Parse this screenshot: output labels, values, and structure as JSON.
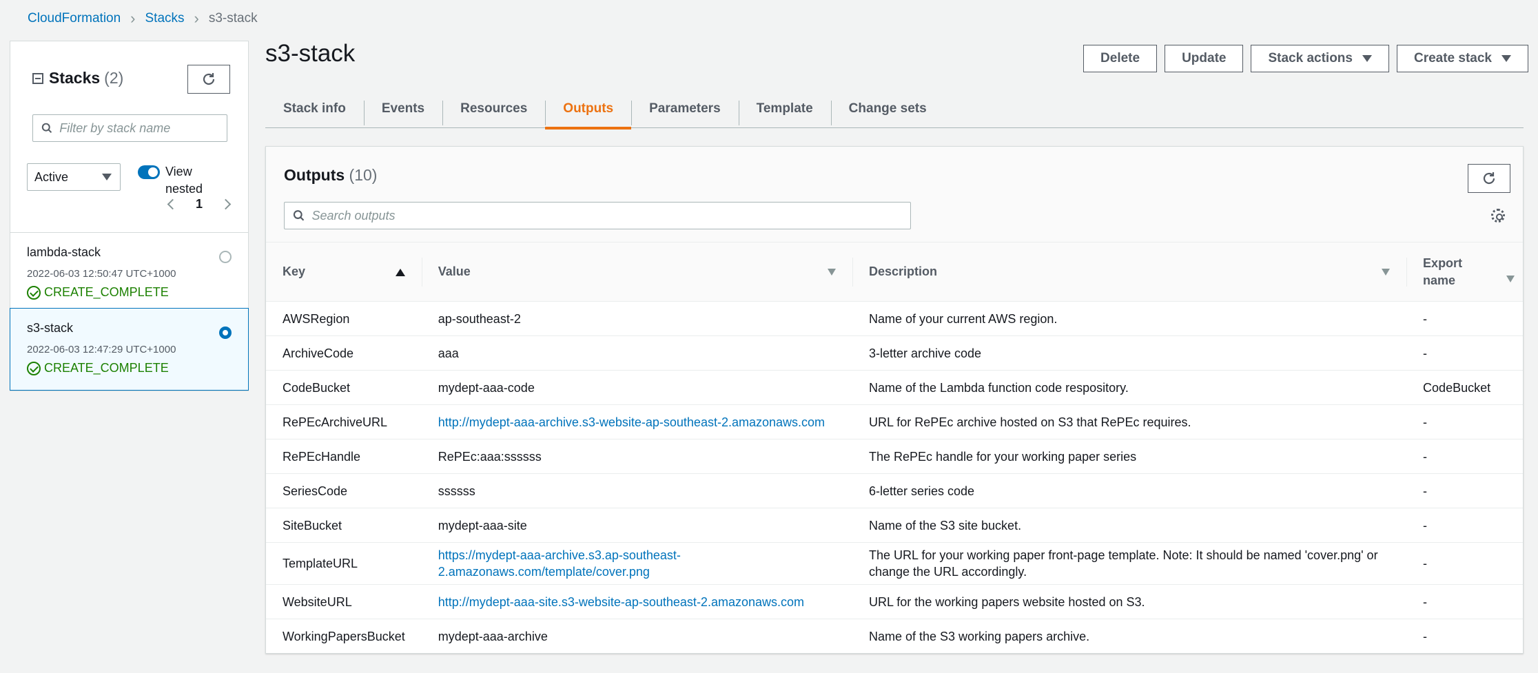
{
  "breadcrumb": {
    "root": "CloudFormation",
    "stacks": "Stacks",
    "current": "s3-stack"
  },
  "sidebar": {
    "title": "Stacks",
    "count": "(2)",
    "filter_placeholder": "Filter by stack name",
    "status_filter": "Active",
    "view_nested_label": "View nested",
    "view_nested_enabled": true,
    "page": "1",
    "stacks": [
      {
        "name": "lambda-stack",
        "date": "2022-06-03 12:50:47 UTC+1000",
        "status": "CREATE_COMPLETE",
        "selected": false
      },
      {
        "name": "s3-stack",
        "date": "2022-06-03 12:47:29 UTC+1000",
        "status": "CREATE_COMPLETE",
        "selected": true
      }
    ]
  },
  "page": {
    "title": "s3-stack",
    "actions": {
      "delete": "Delete",
      "update": "Update",
      "stack_actions": "Stack actions",
      "create_stack": "Create stack"
    },
    "tabs": [
      {
        "label": "Stack info",
        "active": false
      },
      {
        "label": "Events",
        "active": false
      },
      {
        "label": "Resources",
        "active": false
      },
      {
        "label": "Outputs",
        "active": true
      },
      {
        "label": "Parameters",
        "active": false
      },
      {
        "label": "Template",
        "active": false
      },
      {
        "label": "Change sets",
        "active": false
      }
    ]
  },
  "outputs": {
    "title": "Outputs",
    "count": "(10)",
    "search_placeholder": "Search outputs",
    "columns": {
      "key": "Key",
      "value": "Value",
      "description": "Description",
      "export_name": "Export name"
    },
    "rows": [
      {
        "key": "AWSRegion",
        "value": "ap-southeast-2",
        "value_is_link": false,
        "description": "Name of your current AWS region.",
        "export": "-"
      },
      {
        "key": "ArchiveCode",
        "value": "aaa",
        "value_is_link": false,
        "description": "3-letter archive code",
        "export": "-"
      },
      {
        "key": "CodeBucket",
        "value": "mydept-aaa-code",
        "value_is_link": false,
        "description": "Name of the Lambda function code respository.",
        "export": "CodeBucket"
      },
      {
        "key": "RePEcArchiveURL",
        "value": "http://mydept-aaa-archive.s3-website-ap-southeast-2.amazonaws.com",
        "value_is_link": true,
        "description": "URL for RePEc archive hosted on S3 that RePEc requires.",
        "export": "-"
      },
      {
        "key": "RePEcHandle",
        "value": "RePEc:aaa:ssssss",
        "value_is_link": false,
        "description": "The RePEc handle for your working paper series",
        "export": "-"
      },
      {
        "key": "SeriesCode",
        "value": "ssssss",
        "value_is_link": false,
        "description": "6-letter series code",
        "export": "-"
      },
      {
        "key": "SiteBucket",
        "value": "mydept-aaa-site",
        "value_is_link": false,
        "description": "Name of the S3 site bucket.",
        "export": "-"
      },
      {
        "key": "TemplateURL",
        "value": "https://mydept-aaa-archive.s3.ap-southeast-2.amazonaws.com/template/cover.png",
        "value_is_link": true,
        "description": "The URL for your working paper front-page template. Note: It should be named 'cover.png' or change the URL accordingly.",
        "export": "-"
      },
      {
        "key": "WebsiteURL",
        "value": "http://mydept-aaa-site.s3-website-ap-southeast-2.amazonaws.com",
        "value_is_link": true,
        "description": "URL for the working papers website hosted on S3.",
        "export": "-"
      },
      {
        "key": "WorkingPapersBucket",
        "value": "mydept-aaa-archive",
        "value_is_link": false,
        "description": "Name of the S3 working papers archive.",
        "export": "-"
      }
    ]
  },
  "colors": {
    "link": "#0073bb",
    "accent": "#ec7211",
    "success": "#1d8102"
  }
}
